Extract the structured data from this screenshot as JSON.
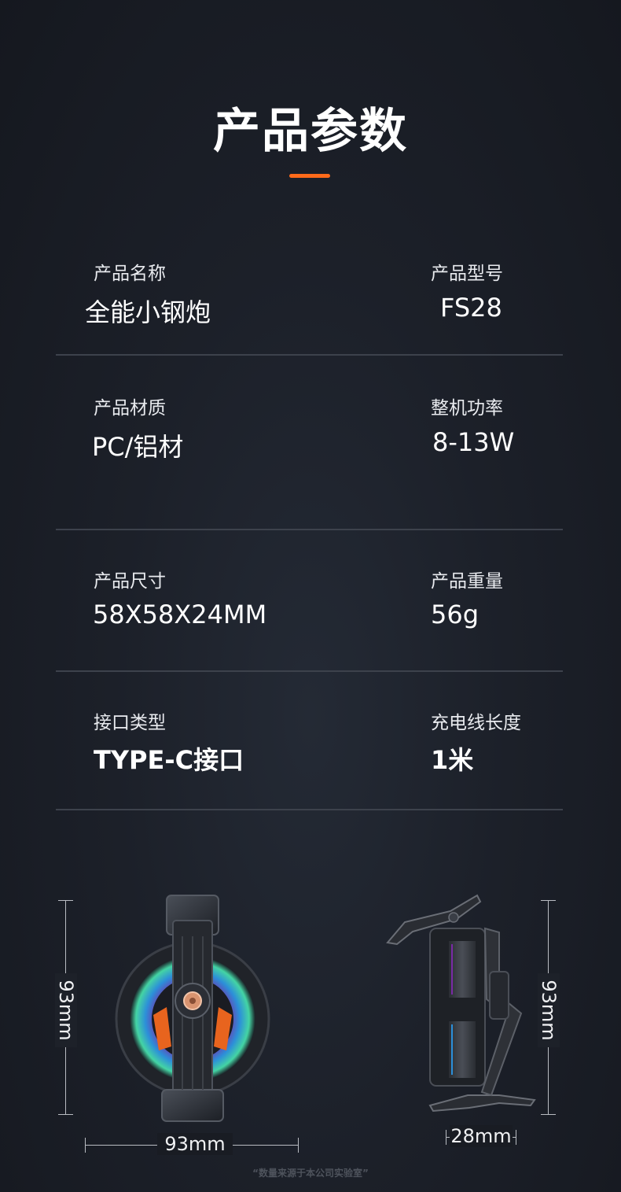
{
  "title": "产品参数",
  "specs": [
    {
      "label": "产品名称",
      "value": "全能小钢炮"
    },
    {
      "label": "产品型号",
      "value": "FS28"
    },
    {
      "label": "产品材质",
      "value": "PC/铝材"
    },
    {
      "label": "整机功率",
      "value": "8-13W"
    },
    {
      "label": "产品尺寸",
      "value": "58X58X24MM"
    },
    {
      "label": "产品重量",
      "value": "56g"
    },
    {
      "label": "接口类型",
      "value": "TYPE-C接口"
    },
    {
      "label": "充电线长度",
      "value": "1米"
    }
  ],
  "dimensions": {
    "front_height": "93mm",
    "front_width": "93mm",
    "side_height": "93mm",
    "side_depth": "28mm"
  },
  "footer": "“数量来源于本公司实验室”",
  "colors": {
    "accent": "#ff6a1a",
    "background": "#1c2029",
    "divider": "#3d424c"
  },
  "icons": [
    "front-view-cooler-image",
    "side-view-cooler-image"
  ]
}
